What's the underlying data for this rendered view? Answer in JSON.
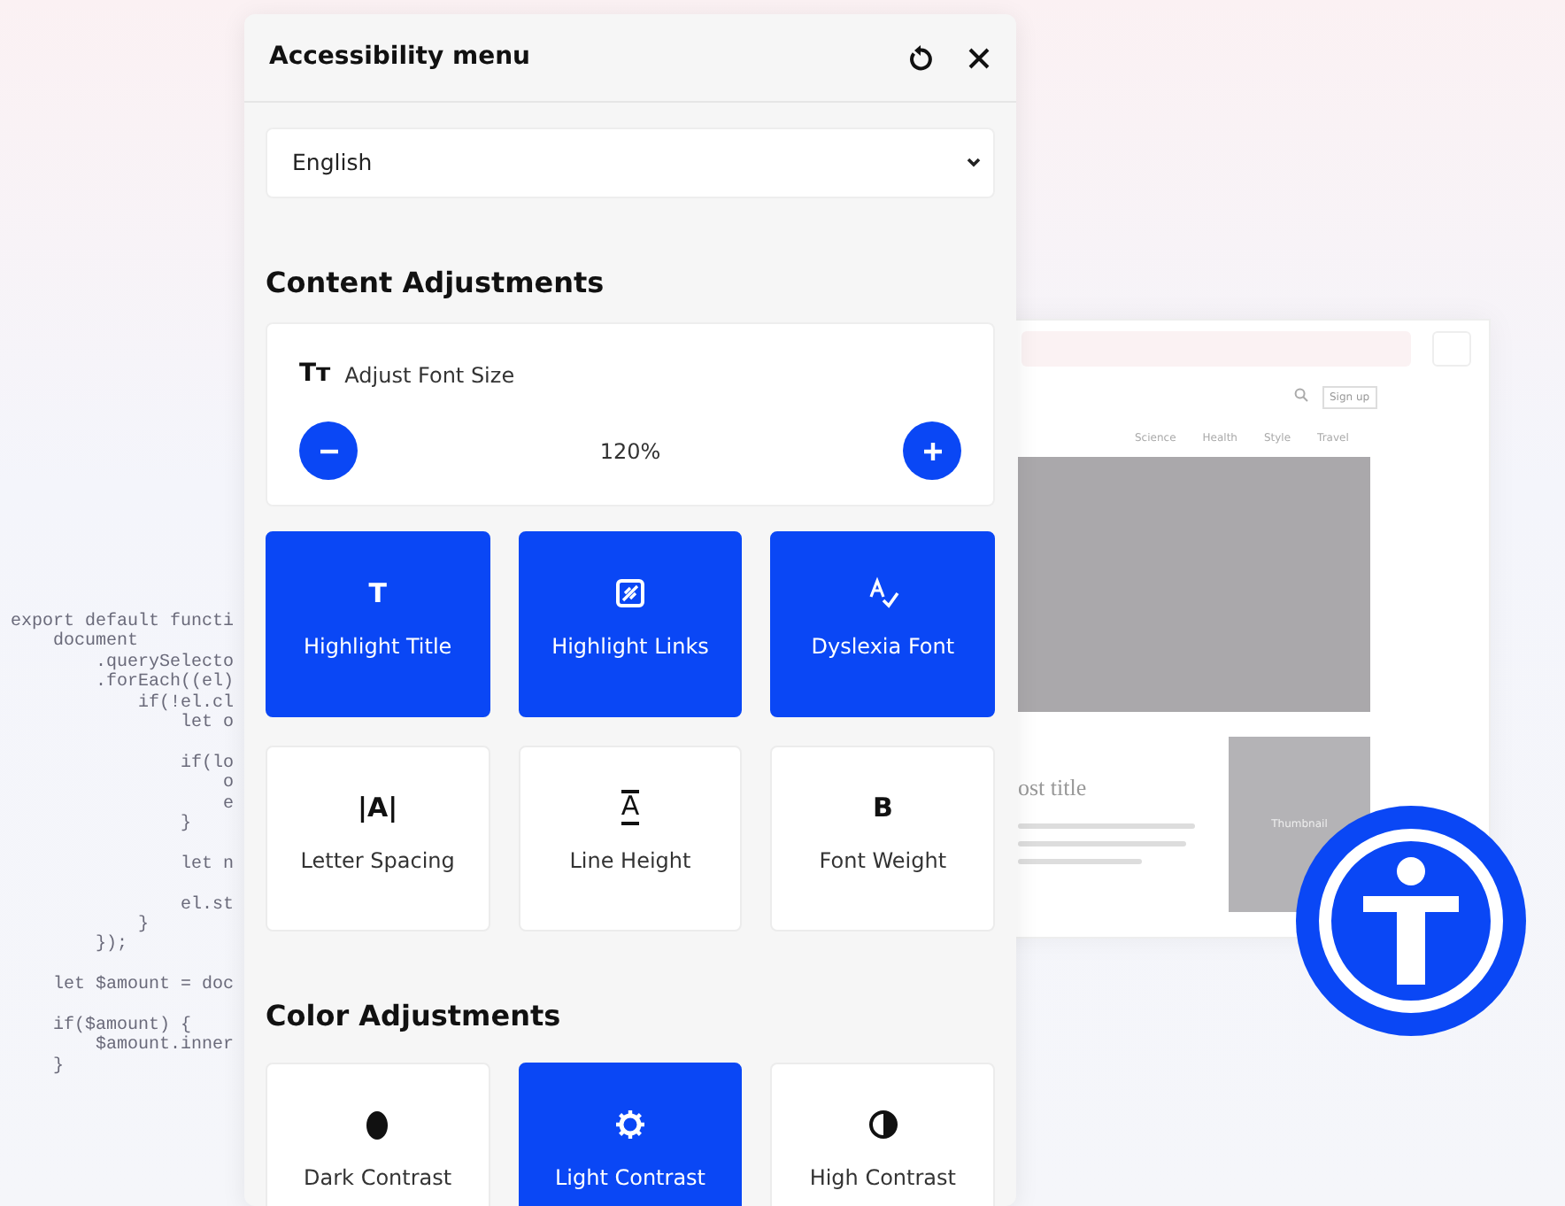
{
  "background_code": {
    "lines": [
      {
        "text": "export default functi",
        "gap_before": false
      },
      {
        "text": "    document",
        "gap_before": false
      },
      {
        "text": "        .querySelecto",
        "gap_before": false
      },
      {
        "text": "        .forEach((el)",
        "gap_before": false
      },
      {
        "text": "            if(!el.cl",
        "gap_before": false
      },
      {
        "text": "                let o",
        "gap_before": false
      },
      {
        "text": "                if(lo",
        "gap_before": true
      },
      {
        "text": "                    o",
        "gap_before": false
      },
      {
        "text": "                    e",
        "gap_before": false
      },
      {
        "text": "                }",
        "gap_before": false
      },
      {
        "text": "                let n",
        "gap_before": true
      },
      {
        "text": "                el.st",
        "gap_before": true
      },
      {
        "text": "            }",
        "gap_before": false
      },
      {
        "text": "        });",
        "gap_before": false
      },
      {
        "text": "    let $amount = doc",
        "gap_before": true
      },
      {
        "text": "    if($amount) {",
        "gap_before": true
      },
      {
        "text": "        $amount.inner",
        "gap_before": false
      },
      {
        "text": "    }",
        "gap_before": false
      }
    ]
  },
  "background_page": {
    "sign_up": "Sign up",
    "nav": [
      "Science",
      "Health",
      "Style",
      "Travel"
    ],
    "post_title": "ost title",
    "thumbnail": "Thumbnail"
  },
  "menu": {
    "title": "Accessibility menu",
    "language": "English",
    "sections": [
      {
        "title": "Content Adjustments",
        "font_size": {
          "icon": "Tт",
          "label": "Adjust Font Size",
          "value": "120%"
        },
        "tiles": [
          {
            "kind": "glyph",
            "glyph": "T",
            "label": "Highlight Title",
            "selected": true
          },
          {
            "kind": "link",
            "label": "Highlight Links",
            "selected": true
          },
          {
            "kind": "spell",
            "label": "Dyslexia Font",
            "selected": true
          },
          {
            "kind": "glyph",
            "glyph": "|A|",
            "label": "Letter Spacing",
            "selected": false
          },
          {
            "kind": "lines",
            "glyph": "A",
            "label": "Line Height",
            "selected": false
          },
          {
            "kind": "glyph",
            "glyph": "B",
            "label": "Font Weight",
            "selected": false
          }
        ]
      },
      {
        "title": "Color Adjustments",
        "tiles": [
          {
            "kind": "drop",
            "label": "Dark Contrast",
            "selected": false
          },
          {
            "kind": "sun",
            "label": "Light Contrast",
            "selected": true
          },
          {
            "kind": "half",
            "label": "High Contrast",
            "selected": false
          }
        ]
      }
    ]
  }
}
